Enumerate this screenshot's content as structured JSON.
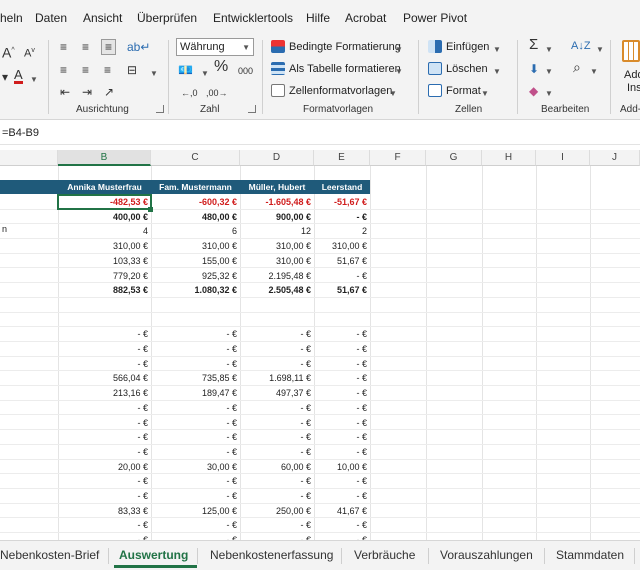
{
  "menu": [
    "heln",
    "Daten",
    "Ansicht",
    "Überprüfen",
    "Entwicklertools",
    "Hilfe",
    "Acrobat",
    "Power Pivot"
  ],
  "ribbon": {
    "font_a_big": "A",
    "font_a_small": "A",
    "font_color_a": "A",
    "number_format_value": "Währung",
    "percent_symbol": "%",
    "thousands_symbol": "000",
    "conditional_formatting": "Bedingte Formatierung",
    "format_as_table": "Als Tabelle formatieren",
    "cell_styles": "Zellenformatvorlagen",
    "insert": "Einfügen",
    "delete": "Löschen",
    "format": "Format",
    "addin_label_1": "Add",
    "addin_label_2": "Ins",
    "groups": {
      "alignment": "Ausrichtung",
      "number": "Zahl",
      "styles": "Formatvorlagen",
      "cells": "Zellen",
      "editing": "Bearbeiten",
      "addins": "Add-"
    },
    "colors": {
      "accent_green": "#217346",
      "font_red": "#d01c1c",
      "table_header_blue": "#1f5a7a"
    }
  },
  "formula_bar": {
    "formula": "=B4-B9"
  },
  "columns": [
    "B",
    "C",
    "D",
    "E",
    "F",
    "G",
    "H",
    "I",
    "J"
  ],
  "selected_column": "B",
  "table": {
    "headers": [
      "Annika Musterfrau",
      "Fam. Mustermann",
      "Müller, Hubert",
      "Leerstand"
    ],
    "row_label_fragment": "n",
    "rows": [
      {
        "style": "neg",
        "cells": [
          "-482,53 €",
          "-600,32 €",
          "-1.605,48 €",
          "-51,67 €"
        ]
      },
      {
        "style": "bold",
        "cells": [
          "400,00 €",
          "480,00 €",
          "900,00 €",
          "-   €"
        ]
      },
      {
        "style": "plain",
        "cells": [
          "4",
          "6",
          "12",
          "2"
        ]
      },
      {
        "style": "plain",
        "cells": [
          "310,00 €",
          "310,00 €",
          "310,00 €",
          "310,00 €"
        ]
      },
      {
        "style": "plain",
        "cells": [
          "103,33 €",
          "155,00 €",
          "310,00 €",
          "51,67 €"
        ]
      },
      {
        "style": "plain",
        "cells": [
          "779,20 €",
          "925,32 €",
          "2.195,48 €",
          "-   €"
        ]
      },
      {
        "style": "bold",
        "cells": [
          "882,53 €",
          "1.080,32 €",
          "2.505,48 €",
          "51,67 €"
        ]
      },
      {
        "style": "empty",
        "cells": [
          "",
          "",
          "",
          ""
        ]
      },
      {
        "style": "empty",
        "cells": [
          "",
          "",
          "",
          ""
        ]
      },
      {
        "style": "plain",
        "cells": [
          "-   €",
          "-   €",
          "-   €",
          "-   €"
        ]
      },
      {
        "style": "plain",
        "cells": [
          "-   €",
          "-   €",
          "-   €",
          "-   €"
        ]
      },
      {
        "style": "plain",
        "cells": [
          "-   €",
          "-   €",
          "-   €",
          "-   €"
        ]
      },
      {
        "style": "plain",
        "cells": [
          "566,04 €",
          "735,85 €",
          "1.698,11 €",
          "-   €"
        ]
      },
      {
        "style": "plain",
        "cells": [
          "213,16 €",
          "189,47 €",
          "497,37 €",
          "-   €"
        ]
      },
      {
        "style": "plain",
        "cells": [
          "-   €",
          "-   €",
          "-   €",
          "-   €"
        ]
      },
      {
        "style": "plain",
        "cells": [
          "-   €",
          "-   €",
          "-   €",
          "-   €"
        ]
      },
      {
        "style": "plain",
        "cells": [
          "-   €",
          "-   €",
          "-   €",
          "-   €"
        ]
      },
      {
        "style": "plain",
        "cells": [
          "-   €",
          "-   €",
          "-   €",
          "-   €"
        ]
      },
      {
        "style": "plain",
        "cells": [
          "20,00 €",
          "30,00 €",
          "60,00 €",
          "10,00 €"
        ]
      },
      {
        "style": "plain",
        "cells": [
          "-   €",
          "-   €",
          "-   €",
          "-   €"
        ]
      },
      {
        "style": "plain",
        "cells": [
          "-   €",
          "-   €",
          "-   €",
          "-   €"
        ]
      },
      {
        "style": "plain",
        "cells": [
          "83,33 €",
          "125,00 €",
          "250,00 €",
          "41,67 €"
        ]
      },
      {
        "style": "plain",
        "cells": [
          "-   €",
          "-   €",
          "-   €",
          "-   €"
        ]
      },
      {
        "style": "plain",
        "cells": [
          "-   €",
          "-   €",
          "-   €",
          "-   €"
        ]
      },
      {
        "style": "plain",
        "cells": [
          "-   €",
          "-   €",
          "-   €",
          "-   €"
        ]
      }
    ]
  },
  "sheet_tabs": [
    "Nebenkosten-Brief",
    "Auswertung",
    "Nebenkostenerfassung",
    "Verbräuche",
    "Vorauszahlungen",
    "Stammdaten"
  ],
  "active_tab": "Auswertung"
}
